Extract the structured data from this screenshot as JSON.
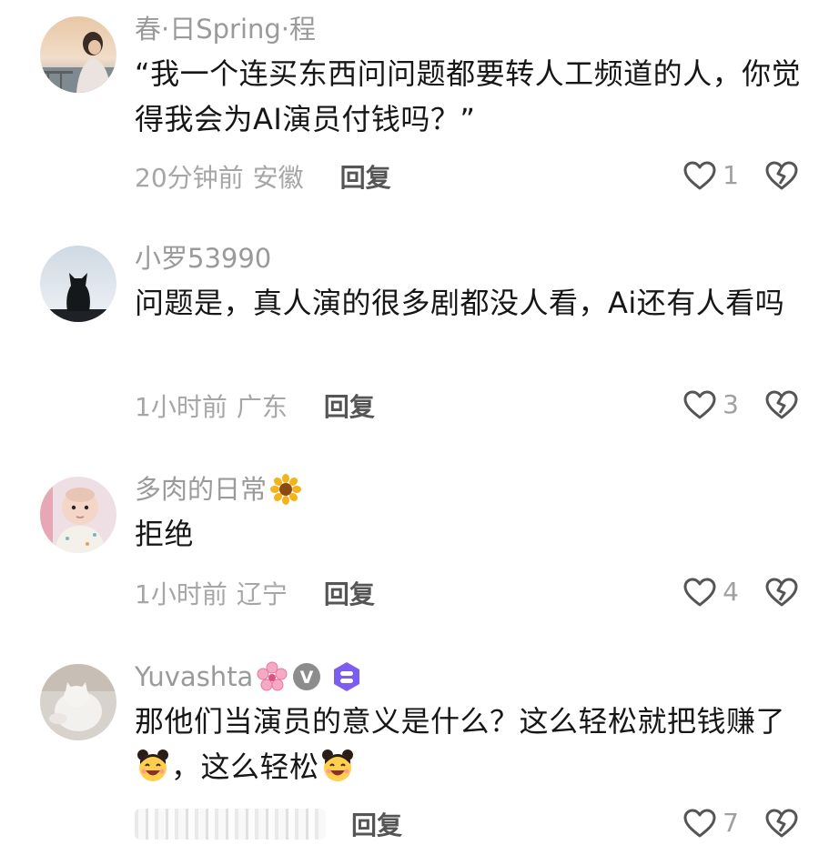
{
  "comments": [
    {
      "username": "春·日Spring·程",
      "text": "“我一个连买东西问问题都要转人工频道的人，你觉得我会为AI演员付钱吗？”",
      "time": "20分钟前",
      "location": "安徽",
      "reply_label": "回复",
      "likes": "1",
      "avatar_icon": "avatar-photo-person-lake"
    },
    {
      "username": "小罗53990",
      "text": "问题是，真人演的很多剧都没人看，Ai还有人看吗",
      "time": "1小时前",
      "location": "广东",
      "reply_label": "回复",
      "likes": "3",
      "avatar_icon": "avatar-photo-cat-silhouette"
    },
    {
      "username": "多肉的日常",
      "username_emoji": "sunflower-emoji",
      "text": "拒绝",
      "time": "1小时前",
      "location": "辽宁",
      "reply_label": "回复",
      "likes": "4",
      "avatar_icon": "avatar-photo-baby"
    },
    {
      "username": "Yuvashta",
      "username_emoji": "cherry-blossom-emoji",
      "badges": [
        "verified-v-badge",
        "level-badge"
      ],
      "verified_letter": "V",
      "text_part1": "那他们当演员的意义是什么？这么轻松就把钱赚了",
      "text_part2": "，这么轻松",
      "inline_emoji": "girl-buns-laughing-emoji",
      "reply_label": "回复",
      "likes": "7",
      "avatar_icon": "avatar-photo-white-cat"
    }
  ],
  "colors": {
    "username": "#9a9a9a",
    "text": "#161616",
    "meta": "#a6a6a6",
    "reply": "#555555",
    "icon_stroke": "#555555",
    "level_badge": "#7d5cf0"
  }
}
